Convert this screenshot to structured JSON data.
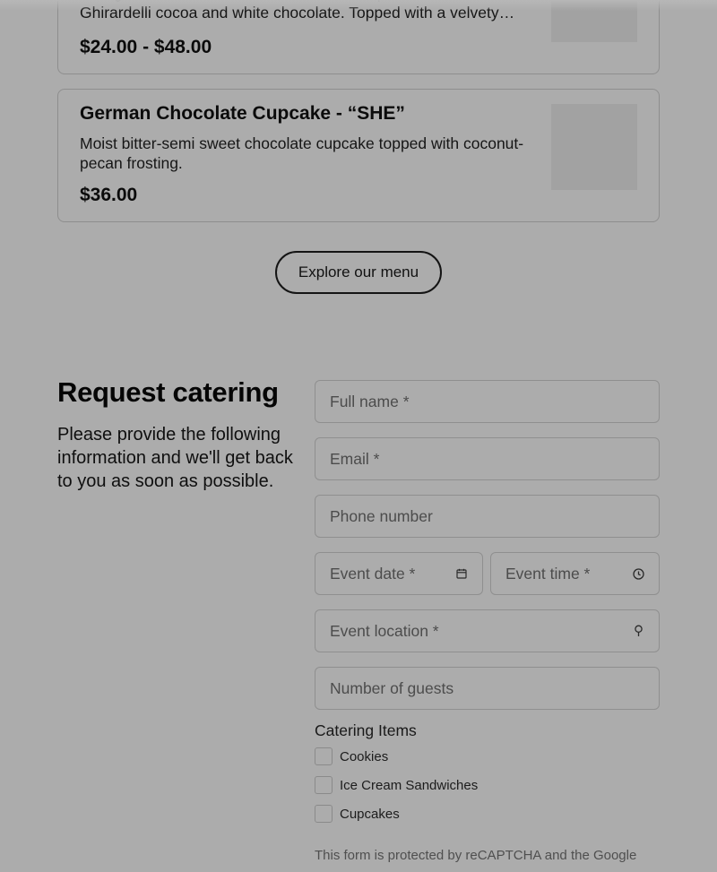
{
  "products": [
    {
      "description": "Indulge in the luxurious red velvet brownie packed with rich Ghirardelli cocoa and white chocolate. Topped with a velvety…",
      "price": "$24.00 - $48.00"
    },
    {
      "title": "German Chocolate Cupcake - “SHE”",
      "description": "Moist bitter-semi sweet chocolate cupcake topped with coconut-pecan frosting.",
      "price": "$36.00"
    }
  ],
  "explore_button": "Explore our menu",
  "catering": {
    "heading": "Request catering",
    "intro": "Please provide the following information and we'll get back to you as soon as possible.",
    "fields": {
      "full_name": "Full name *",
      "email": "Email *",
      "phone": "Phone number",
      "event_date": "Event date *",
      "event_time": "Event time *",
      "event_location": "Event location *",
      "guests": "Number of guests"
    },
    "items_label": "Catering Items",
    "items": [
      "Cookies",
      "Ice Cream Sandwiches",
      "Cupcakes"
    ],
    "recaptcha": "This form is protected by reCAPTCHA and the Google"
  },
  "icons": {
    "date": "calendar-icon",
    "time": "clock-icon",
    "location": "map-pin-icon"
  }
}
